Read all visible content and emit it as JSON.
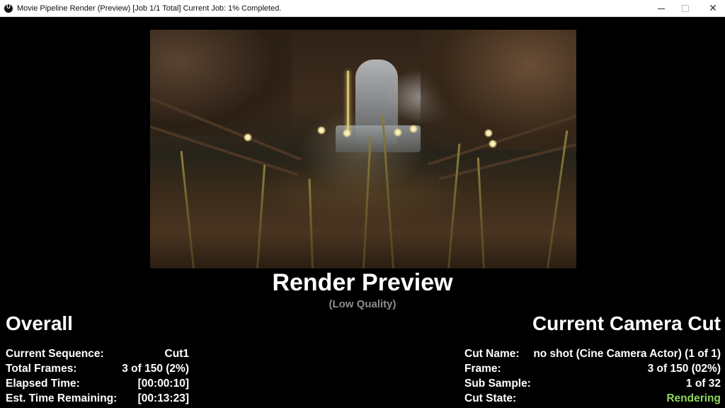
{
  "window": {
    "title": "Movie Pipeline Render (Preview) [Job 1/1 Total] Current Job: 1% Completed.",
    "controls": {
      "minimize": "—",
      "maximize": "☐",
      "close": "✕"
    }
  },
  "preview": {
    "title": "Render Preview",
    "subtitle": "(Low Quality)"
  },
  "overall": {
    "heading": "Overall",
    "rows": [
      {
        "label": "Current Sequence:",
        "value": "Cut1"
      },
      {
        "label": "Total Frames:",
        "value": "3 of 150 (2%)"
      },
      {
        "label": "Elapsed Time:",
        "value": "[00:00:10]"
      },
      {
        "label": "Est. Time Remaining:",
        "value": "[00:13:23]"
      }
    ]
  },
  "camera_cut": {
    "heading": "Current Camera Cut",
    "rows": [
      {
        "label": "Cut Name:",
        "value": "no shot (Cine Camera Actor) (1 of 1)"
      },
      {
        "label": "Frame:",
        "value": "3 of 150 (02%)"
      },
      {
        "label": "Sub Sample:",
        "value": "1 of 32"
      },
      {
        "label": "Cut State:",
        "value": "Rendering"
      }
    ]
  },
  "colors": {
    "background": "#000000",
    "text": "#ffffff",
    "subtitle": "#8c8c8c",
    "state_rendering": "#8ed65c"
  }
}
